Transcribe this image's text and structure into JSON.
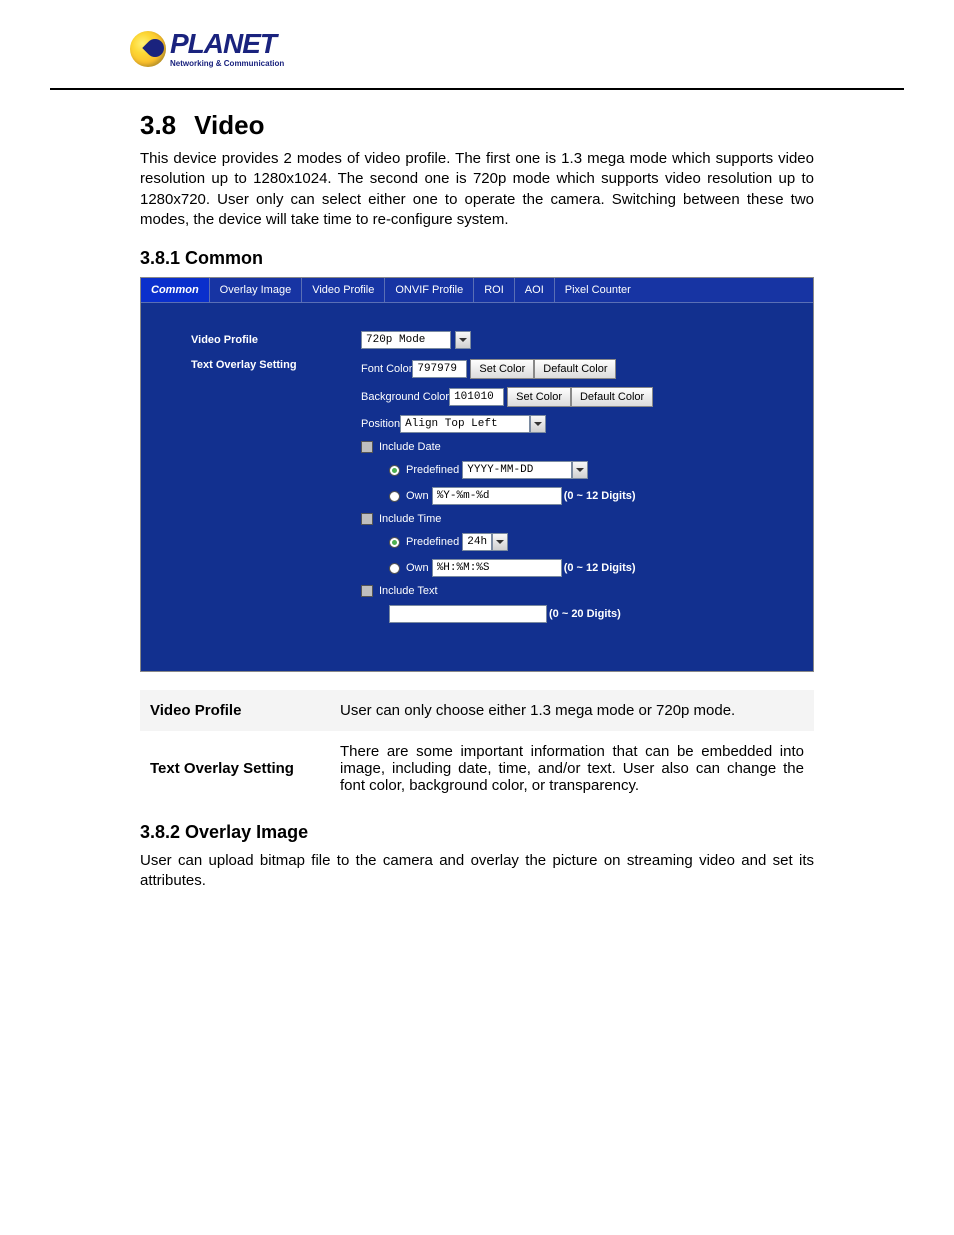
{
  "logo": {
    "word": "PLANET",
    "tag": "Networking & Communication"
  },
  "section": {
    "num": "3.8",
    "title": "Video"
  },
  "intro": "This device provides 2 modes of video profile. The first one is 1.3 mega mode which supports video resolution up to 1280x1024. The second one is 720p mode which supports video resolution up to 1280x720. User only can select either one to operate the camera. Switching between these two modes, the device will take time to re-configure system.",
  "sub1": "3.8.1 Common",
  "tabs": [
    "Common",
    "Overlay Image",
    "Video Profile",
    "ONVIF Profile",
    "ROI",
    "AOI",
    "Pixel Counter"
  ],
  "form": {
    "video_profile_label": "Video Profile",
    "video_profile_value": "720p Mode",
    "text_overlay_label": "Text Overlay Setting",
    "font_color_label": "Font Color",
    "font_color_value": "797979",
    "set_color_btn": "Set Color",
    "default_color_btn": "Default Color",
    "bg_color_label": "Background Color",
    "bg_color_value": "101010",
    "position_label": "Position",
    "position_value": "Align Top Left",
    "include_date": "Include Date",
    "predefined": "Predefined",
    "date_predef_value": "YYYY-MM-DD",
    "own": "Own",
    "date_own_value": "%Y-%m-%d",
    "hint12": "(0 ~ 12 Digits)",
    "include_time": "Include Time",
    "time_predef_value": "24h",
    "time_own_value": "%H:%M:%S",
    "include_text": "Include Text",
    "text_value": "",
    "hint20": "(0 ~ 20 Digits)"
  },
  "desc": [
    {
      "k": "Video Profile",
      "v": "User can only choose either 1.3 mega mode or 720p mode."
    },
    {
      "k": "Text Overlay Setting",
      "v": "There are some important information that can be embedded into image, including date, time, and/or text. User also can change the font color, background color, or transparency."
    }
  ],
  "sub2": "3.8.2 Overlay Image",
  "overlay_p": "User can upload bitmap file to the camera and overlay the picture on streaming video and set its attributes."
}
